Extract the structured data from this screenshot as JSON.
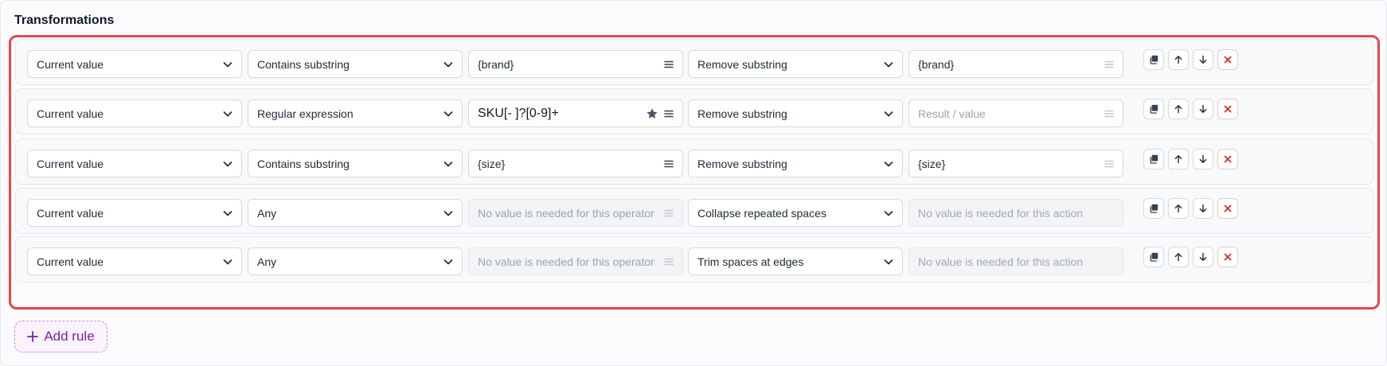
{
  "section": {
    "title": "Transformations"
  },
  "rules": [
    {
      "source": "Current value",
      "operator": "Contains substring",
      "pattern": {
        "value": "{brand}",
        "placeholder": "",
        "disabled": false,
        "starred": false
      },
      "action": "Remove substring",
      "result": {
        "value": "{brand}",
        "placeholder": "Result / value",
        "disabled": false
      }
    },
    {
      "source": "Current value",
      "operator": "Regular expression",
      "pattern": {
        "value": "SKU[- ]?[0-9]+",
        "placeholder": "",
        "disabled": false,
        "starred": true
      },
      "action": "Remove substring",
      "result": {
        "value": "",
        "placeholder": "Result / value",
        "disabled": false
      }
    },
    {
      "source": "Current value",
      "operator": "Contains substring",
      "pattern": {
        "value": "{size}",
        "placeholder": "",
        "disabled": false,
        "starred": false
      },
      "action": "Remove substring",
      "result": {
        "value": "{size}",
        "placeholder": "Result / value",
        "disabled": false
      }
    },
    {
      "source": "Current value",
      "operator": "Any",
      "pattern": {
        "value": "",
        "placeholder": "No value is needed for this operator",
        "disabled": true,
        "starred": false
      },
      "action": "Collapse repeated spaces",
      "result": {
        "value": "",
        "placeholder": "No value is needed for this action",
        "disabled": true
      }
    },
    {
      "source": "Current value",
      "operator": "Any",
      "pattern": {
        "value": "",
        "placeholder": "No value is needed for this operator",
        "disabled": true,
        "starred": false
      },
      "action": "Trim spaces at edges",
      "result": {
        "value": "",
        "placeholder": "No value is needed for this action",
        "disabled": true
      }
    }
  ],
  "icons": {
    "select": "chevron-down-icon",
    "pattern_menu": "menu-icon",
    "regex_star": "star-icon",
    "duplicate": "duplicate-icon",
    "move_up": "arrow-up-icon",
    "move_down": "arrow-down-icon",
    "delete": "close-icon"
  },
  "add_rule": {
    "label": "Add rule"
  },
  "colors": {
    "highlight_border": "#e0484d",
    "delete_icon": "#dc2626",
    "add_rule_accent": "#7b1fa2"
  }
}
